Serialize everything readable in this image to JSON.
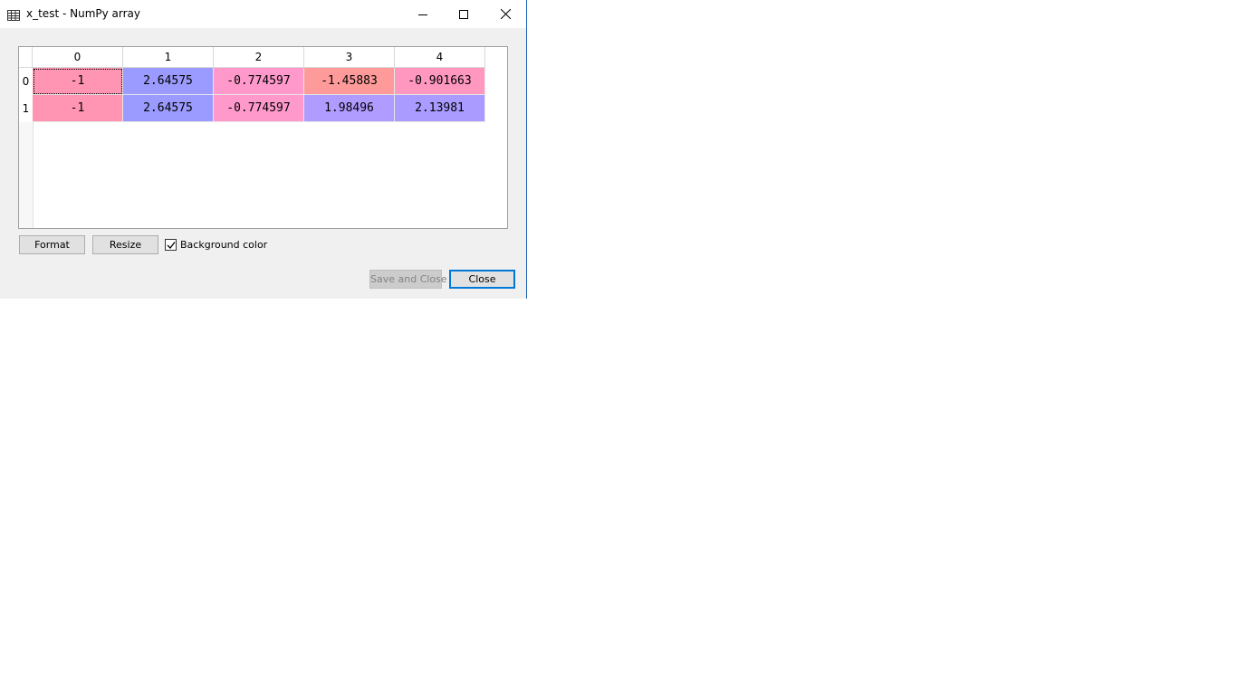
{
  "window": {
    "title": "x_test - NumPy array",
    "icon": "table-icon"
  },
  "table": {
    "columns": [
      "0",
      "1",
      "2",
      "3",
      "4"
    ],
    "rows": [
      {
        "label": "0",
        "cells": [
          {
            "value": "-1",
            "color": "#ff95b2"
          },
          {
            "value": "2.64575",
            "color": "#9b9bff"
          },
          {
            "value": "-0.774597",
            "color": "#ff99cc"
          },
          {
            "value": "-1.45883",
            "color": "#ff9a9a"
          },
          {
            "value": "-0.901663",
            "color": "#ff97bf"
          }
        ]
      },
      {
        "label": "1",
        "cells": [
          {
            "value": "-1",
            "color": "#ff95b2"
          },
          {
            "value": "2.64575",
            "color": "#9b9bff"
          },
          {
            "value": "-0.774597",
            "color": "#ff99cc"
          },
          {
            "value": "1.98496",
            "color": "#b09bff"
          },
          {
            "value": "2.13981",
            "color": "#a99bff"
          }
        ]
      }
    ]
  },
  "controls": {
    "format_label": "Format",
    "resize_label": "Resize",
    "background_color_label": "Background color",
    "background_color_checked": true,
    "save_close_label": "Save and Close",
    "close_label": "Close"
  }
}
